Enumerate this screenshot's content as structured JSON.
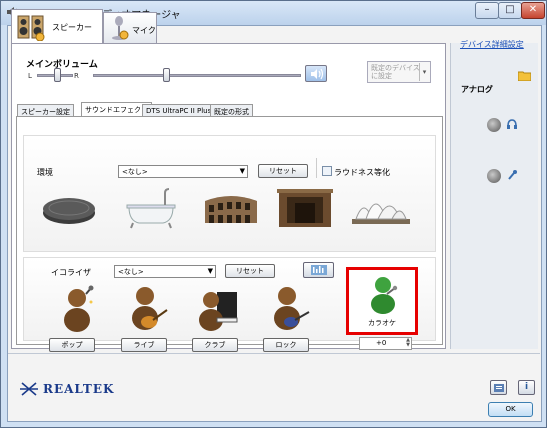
{
  "window": {
    "title": "Realtek HD オーディオマネージャ",
    "controls": {
      "minimize": "–",
      "maximize": "□",
      "close": "✕"
    }
  },
  "device_tabs": [
    {
      "label": "スピーカー",
      "selected": true,
      "icon": "speaker-icon"
    },
    {
      "label": "マイク",
      "selected": false,
      "icon": "microphone-icon"
    }
  ],
  "main_volume": {
    "title": "メインボリューム",
    "left_label": "L",
    "right_label": "R",
    "balance": 0.45,
    "level": 0.6
  },
  "default_device": {
    "label": "既定のデバイス\nに設定"
  },
  "sub_tabs": [
    {
      "label": "スピーカー設定",
      "selected": false
    },
    {
      "label": "サウンドエフェクト",
      "selected": true
    },
    {
      "label": "DTS UltraPC II Plus",
      "selected": false
    },
    {
      "label": "既定の形式",
      "selected": false
    }
  ],
  "environment": {
    "label": "環境",
    "value": "<なし>",
    "reset_label": "リセット",
    "loudness_label": "ラウドネス等化",
    "loudness_checked": false,
    "presets": [
      "stone-floor-icon",
      "bathtub-icon",
      "colosseum-icon",
      "stone-corridor-icon",
      "opera-house-icon"
    ]
  },
  "equalizer": {
    "label": "イコライザ",
    "value": "<なし>",
    "reset_label": "リセット",
    "presets": [
      {
        "label": "ポップ",
        "icon": "pop-singer-icon"
      },
      {
        "label": "ライブ",
        "icon": "guitar-player-icon"
      },
      {
        "label": "クラブ",
        "icon": "piano-player-icon"
      },
      {
        "label": "ロック",
        "icon": "rock-guitar-icon"
      }
    ],
    "karaoke": {
      "label": "カラオケ",
      "value": "+0"
    }
  },
  "side": {
    "advanced_link": "デバイス詳細設定",
    "analog_label": "アナログ"
  },
  "footer": {
    "brand": "REALTEK",
    "ok_label": "OK"
  }
}
